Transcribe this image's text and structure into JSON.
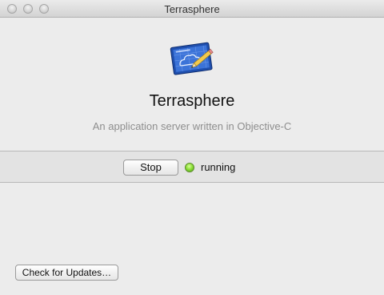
{
  "window": {
    "title": "Terrasphere"
  },
  "app": {
    "icon": "blueprint-pencil-icon",
    "name": "Terrasphere",
    "description": "An application server written in Objective-C"
  },
  "server": {
    "stop_label": "Stop",
    "status_text": "running",
    "status_color": "#8ee03a"
  },
  "footer": {
    "check_updates_label": "Check for Updates…"
  }
}
